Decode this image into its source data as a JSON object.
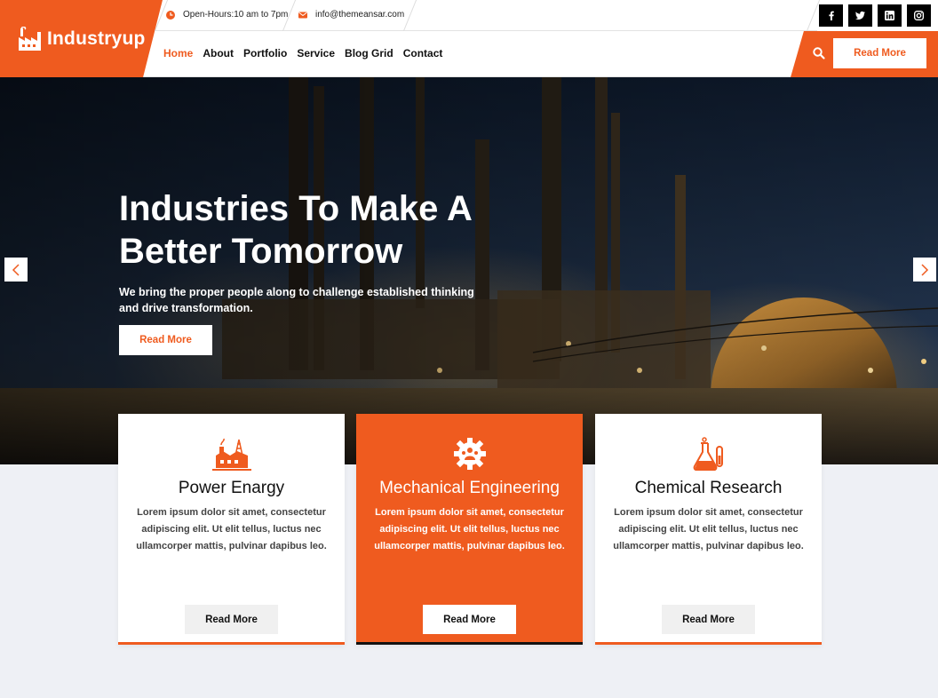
{
  "brand": {
    "name": "Industryup",
    "accent": "#ef5b1f",
    "dark": "#111111"
  },
  "topbar": {
    "hours": "Open-Hours:10 am to 7pm",
    "email": "info@themeansar.com",
    "socials": [
      {
        "icon": "facebook-icon",
        "glyph": "f"
      },
      {
        "icon": "twitter-icon",
        "glyph": "t"
      },
      {
        "icon": "linkedin-icon",
        "glyph": "in"
      },
      {
        "icon": "instagram-icon",
        "glyph": "ig"
      }
    ]
  },
  "nav": {
    "items": [
      "Home",
      "About",
      "Portfolio",
      "Service",
      "Blog Grid",
      "Contact"
    ],
    "active": "Home",
    "read_more": "Read More"
  },
  "hero": {
    "title": "Industries To Make A Better Tomorrow",
    "text": "We bring the proper people along to challenge established thinking and drive transformation.",
    "button": "Read More"
  },
  "cards": [
    {
      "title": "Power Enargy",
      "text": "Lorem ipsum dolor sit amet, consectetur adipiscing elit. Ut elit tellus, luctus nec ullamcorper mattis, pulvinar dapibus leo.",
      "button": "Read More",
      "icon": "power-plant-icon"
    },
    {
      "title": "Mechanical Engineering",
      "text": "Lorem ipsum dolor sit amet, consectetur adipiscing elit. Ut elit tellus, luctus nec ullamcorper mattis, pulvinar dapibus leo.",
      "button": "Read More",
      "icon": "gear-team-icon"
    },
    {
      "title": "Chemical Research",
      "text": "Lorem ipsum dolor sit amet, consectetur adipiscing elit. Ut elit tellus, luctus nec ullamcorper mattis, pulvinar dapibus leo.",
      "button": "Read More",
      "icon": "flask-icon"
    }
  ]
}
